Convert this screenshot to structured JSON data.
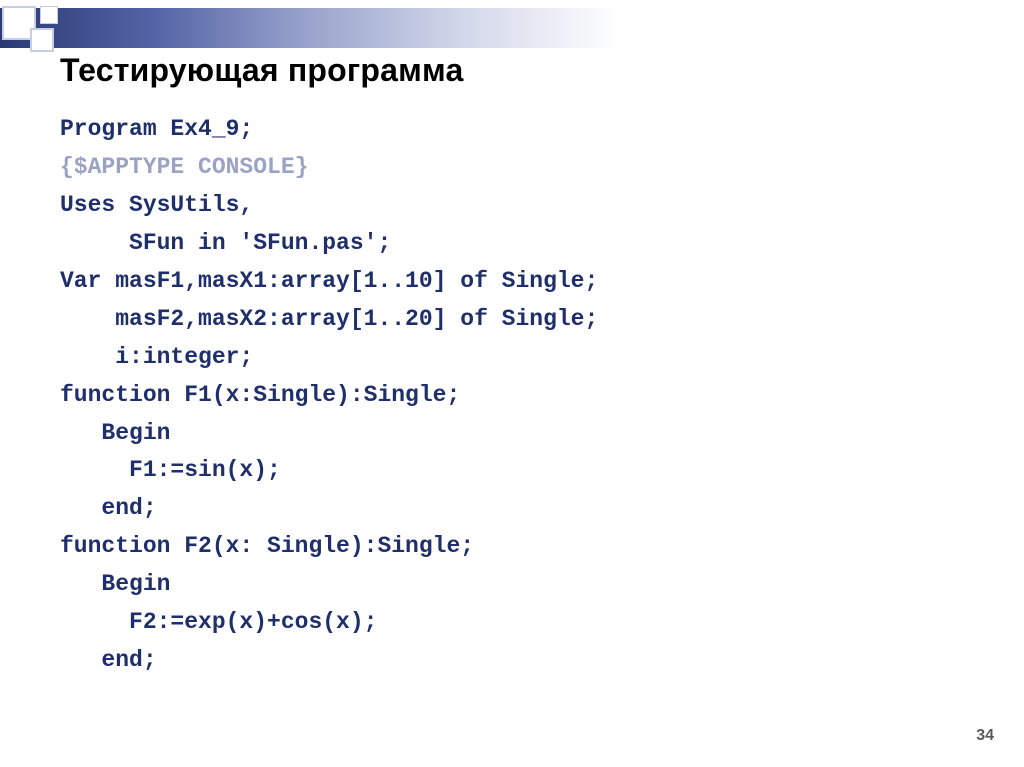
{
  "title": "Тестирующая программа",
  "code": {
    "l1": "Program Ex4_9;",
    "l2": "{$APPTYPE CONSOLE}",
    "l3": "Uses SysUtils,",
    "l4": "     SFun in 'SFun.pas';",
    "l5": "Var masF1,masX1:array[1..10] of Single;",
    "l6": "    masF2,masX2:array[1..20] of Single;",
    "l7": "    i:integer;",
    "l8": "function F1(x:Single):Single;",
    "l9": "   Begin",
    "l10": "     F1:=sin(x);",
    "l11": "   end;",
    "l12": "function F2(x: Single):Single;",
    "l13": "   Begin",
    "l14": "     F2:=exp(x)+cos(x);",
    "l15": "   end;"
  },
  "page_number": "34"
}
